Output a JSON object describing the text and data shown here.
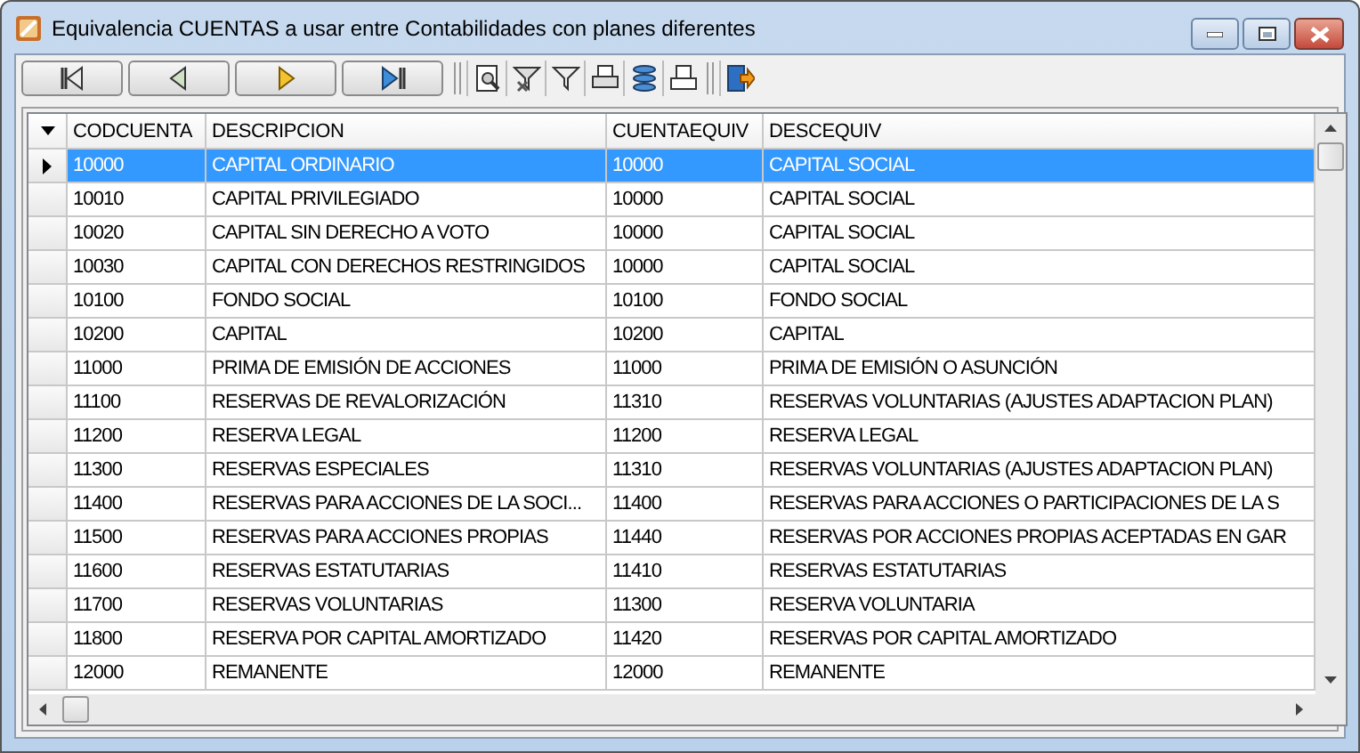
{
  "window": {
    "title": "Equivalencia CUENTAS a usar entre Contabilidades con planes diferentes"
  },
  "toolbar": {
    "nav_buttons": [
      {
        "kind": "first"
      },
      {
        "kind": "prev"
      },
      {
        "kind": "next"
      },
      {
        "kind": "last"
      }
    ],
    "tools": [
      {
        "kind": "preview"
      },
      {
        "kind": "filter-clear"
      },
      {
        "kind": "filter"
      },
      {
        "kind": "print-setup"
      },
      {
        "kind": "layers"
      },
      {
        "kind": "print"
      },
      {
        "kind": "exit"
      }
    ]
  },
  "table": {
    "columns": [
      "CODCUENTA",
      "DESCRIPCION",
      "CUENTAEQUIV",
      "DESCEQUIV"
    ],
    "rows": [
      {
        "selected": true,
        "cells": [
          "10000",
          "CAPITAL ORDINARIO",
          "10000",
          "CAPITAL SOCIAL"
        ]
      },
      {
        "selected": false,
        "cells": [
          "10010",
          "CAPITAL PRIVILEGIADO",
          "10000",
          "CAPITAL SOCIAL"
        ]
      },
      {
        "selected": false,
        "cells": [
          "10020",
          "CAPITAL SIN DERECHO A VOTO",
          "10000",
          "CAPITAL SOCIAL"
        ]
      },
      {
        "selected": false,
        "cells": [
          "10030",
          "CAPITAL CON DERECHOS RESTRINGIDOS",
          "10000",
          "CAPITAL SOCIAL"
        ]
      },
      {
        "selected": false,
        "cells": [
          "10100",
          "FONDO SOCIAL",
          "10100",
          "FONDO SOCIAL"
        ]
      },
      {
        "selected": false,
        "cells": [
          "10200",
          "CAPITAL",
          "10200",
          "CAPITAL"
        ]
      },
      {
        "selected": false,
        "cells": [
          "11000",
          "PRIMA DE EMISIÓN DE ACCIONES",
          "11000",
          "PRIMA DE EMISIÓN O ASUNCIÓN"
        ]
      },
      {
        "selected": false,
        "cells": [
          "11100",
          "RESERVAS DE REVALORIZACIÓN",
          "11310",
          "RESERVAS VOLUNTARIAS (AJUSTES ADAPTACION PLAN)"
        ]
      },
      {
        "selected": false,
        "cells": [
          "11200",
          "RESERVA LEGAL",
          "11200",
          "RESERVA LEGAL"
        ]
      },
      {
        "selected": false,
        "cells": [
          "11300",
          "RESERVAS ESPECIALES",
          "11310",
          "RESERVAS VOLUNTARIAS (AJUSTES ADAPTACION PLAN)"
        ]
      },
      {
        "selected": false,
        "cells": [
          "11400",
          "RESERVAS PARA ACCIONES DE LA SOCI...",
          "11400",
          "RESERVAS PARA ACCIONES O PARTICIPACIONES DE LA S"
        ]
      },
      {
        "selected": false,
        "cells": [
          "11500",
          "RESERVAS PARA ACCIONES PROPIAS",
          "11440",
          "RESERVAS POR ACCIONES PROPIAS ACEPTADAS EN GAR"
        ]
      },
      {
        "selected": false,
        "cells": [
          "11600",
          "RESERVAS ESTATUTARIAS",
          "11410",
          "RESERVAS ESTATUTARIAS"
        ]
      },
      {
        "selected": false,
        "cells": [
          "11700",
          "RESERVAS VOLUNTARIAS",
          "11300",
          "RESERVA VOLUNTARIA"
        ]
      },
      {
        "selected": false,
        "cells": [
          "11800",
          "RESERVA POR CAPITAL AMORTIZADO",
          "11420",
          "RESERVAS POR CAPITAL AMORTIZADO"
        ]
      },
      {
        "selected": false,
        "cells": [
          "12000",
          "REMANENTE",
          "12000",
          "REMANENTE"
        ]
      }
    ]
  }
}
